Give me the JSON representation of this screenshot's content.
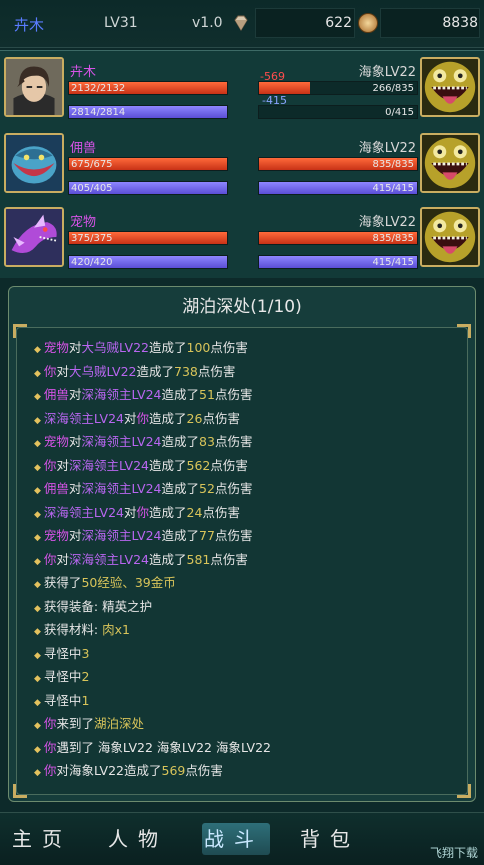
{
  "topbar": {
    "player_name": "卉木",
    "level": "LV31",
    "version": "v1.0",
    "gems": "622",
    "gold": "8838"
  },
  "party": [
    {
      "name": "卉木",
      "hp": "2132/2132",
      "hp_frac": 1.0,
      "mp": "2814/2814",
      "mp_frac": 1.0,
      "avatar_icon": "hero-portrait-icon",
      "enemy": {
        "name": "海象LV22",
        "hp": "266/835",
        "hp_frac": 0.32,
        "mp": "0/415",
        "mp_frac": 0.0,
        "damage_hp": "-569",
        "damage_mp": "-415",
        "icon": "sea-monster-icon"
      }
    },
    {
      "name": "佣兽",
      "hp": "675/675",
      "hp_frac": 1.0,
      "mp": "405/405",
      "mp_frac": 1.0,
      "avatar_icon": "blue-beast-icon",
      "enemy": {
        "name": "海象LV22",
        "hp": "835/835",
        "hp_frac": 1.0,
        "mp": "415/415",
        "mp_frac": 1.0,
        "icon": "sea-monster-icon"
      }
    },
    {
      "name": "宠物",
      "hp": "375/375",
      "hp_frac": 1.0,
      "mp": "420/420",
      "mp_frac": 1.0,
      "avatar_icon": "purple-dragon-icon",
      "enemy": {
        "name": "海象LV22",
        "hp": "835/835",
        "hp_frac": 1.0,
        "mp": "415/415",
        "mp_frac": 1.0,
        "icon": "sea-monster-icon"
      }
    }
  ],
  "battle": {
    "title": "湖泊深处(1/10)",
    "log": [
      [
        {
          "t": "宠物",
          "c": "pk"
        },
        {
          "t": "对",
          "c": "wh"
        },
        {
          "t": "大乌贼LV22",
          "c": "en"
        },
        {
          "t": "造成了",
          "c": "wh"
        },
        {
          "t": "100",
          "c": "ye"
        },
        {
          "t": "点伤害",
          "c": "wh"
        }
      ],
      [
        {
          "t": "你",
          "c": "pk"
        },
        {
          "t": "对",
          "c": "wh"
        },
        {
          "t": "大乌贼LV22",
          "c": "en"
        },
        {
          "t": "造成了",
          "c": "wh"
        },
        {
          "t": "738",
          "c": "ye"
        },
        {
          "t": "点伤害",
          "c": "wh"
        }
      ],
      [
        {
          "t": "佣兽",
          "c": "pk"
        },
        {
          "t": "对",
          "c": "wh"
        },
        {
          "t": "深海领主LV24",
          "c": "en"
        },
        {
          "t": "造成了",
          "c": "wh"
        },
        {
          "t": "51",
          "c": "ye"
        },
        {
          "t": "点伤害",
          "c": "wh"
        }
      ],
      [
        {
          "t": "深海领主LV24",
          "c": "en"
        },
        {
          "t": "对",
          "c": "wh"
        },
        {
          "t": "你",
          "c": "pk"
        },
        {
          "t": "造成了",
          "c": "wh"
        },
        {
          "t": "26",
          "c": "ye"
        },
        {
          "t": "点伤害",
          "c": "wh"
        }
      ],
      [
        {
          "t": "宠物",
          "c": "pk"
        },
        {
          "t": "对",
          "c": "wh"
        },
        {
          "t": "深海领主LV24",
          "c": "en"
        },
        {
          "t": "造成了",
          "c": "wh"
        },
        {
          "t": "83",
          "c": "ye"
        },
        {
          "t": "点伤害",
          "c": "wh"
        }
      ],
      [
        {
          "t": "你",
          "c": "pk"
        },
        {
          "t": "对",
          "c": "wh"
        },
        {
          "t": "深海领主LV24",
          "c": "en"
        },
        {
          "t": "造成了",
          "c": "wh"
        },
        {
          "t": "562",
          "c": "ye"
        },
        {
          "t": "点伤害",
          "c": "wh"
        }
      ],
      [
        {
          "t": "佣兽",
          "c": "pk"
        },
        {
          "t": "对",
          "c": "wh"
        },
        {
          "t": "深海领主LV24",
          "c": "en"
        },
        {
          "t": "造成了",
          "c": "wh"
        },
        {
          "t": "52",
          "c": "ye"
        },
        {
          "t": "点伤害",
          "c": "wh"
        }
      ],
      [
        {
          "t": "深海领主LV24",
          "c": "en"
        },
        {
          "t": "对",
          "c": "wh"
        },
        {
          "t": "你",
          "c": "pk"
        },
        {
          "t": "造成了",
          "c": "wh"
        },
        {
          "t": "24",
          "c": "ye"
        },
        {
          "t": "点伤害",
          "c": "wh"
        }
      ],
      [
        {
          "t": "宠物",
          "c": "pk"
        },
        {
          "t": "对",
          "c": "wh"
        },
        {
          "t": "深海领主LV24",
          "c": "en"
        },
        {
          "t": "造成了",
          "c": "wh"
        },
        {
          "t": "77",
          "c": "ye"
        },
        {
          "t": "点伤害",
          "c": "wh"
        }
      ],
      [
        {
          "t": "你",
          "c": "pk"
        },
        {
          "t": "对",
          "c": "wh"
        },
        {
          "t": "深海领主LV24",
          "c": "en"
        },
        {
          "t": "造成了",
          "c": "wh"
        },
        {
          "t": "581",
          "c": "ye"
        },
        {
          "t": "点伤害",
          "c": "wh"
        }
      ],
      [
        {
          "t": "获得了",
          "c": "wh"
        },
        {
          "t": "50经验、39金币",
          "c": "ye"
        }
      ],
      [
        {
          "t": "获得装备: 精英之护",
          "c": "wh"
        }
      ],
      [
        {
          "t": "获得材料: ",
          "c": "wh"
        },
        {
          "t": "肉x1",
          "c": "ye"
        }
      ],
      [
        {
          "t": "寻怪中",
          "c": "wh"
        },
        {
          "t": "3",
          "c": "ye"
        }
      ],
      [
        {
          "t": "寻怪中",
          "c": "wh"
        },
        {
          "t": "2",
          "c": "ye"
        }
      ],
      [
        {
          "t": "寻怪中",
          "c": "wh"
        },
        {
          "t": "1",
          "c": "ye"
        }
      ],
      [
        {
          "t": "你",
          "c": "pk"
        },
        {
          "t": "来到了",
          "c": "wh"
        },
        {
          "t": "湖泊深处",
          "c": "ye"
        }
      ],
      [
        {
          "t": "你",
          "c": "pk"
        },
        {
          "t": "遇到了 海象LV22 海象LV22 海象LV22",
          "c": "wh"
        }
      ],
      [
        {
          "t": "你",
          "c": "pk"
        },
        {
          "t": "对海象LV22造成了",
          "c": "wh"
        },
        {
          "t": "569",
          "c": "ye"
        },
        {
          "t": "点伤害",
          "c": "wh"
        }
      ]
    ]
  },
  "nav": {
    "tabs": [
      {
        "label": "主页",
        "active": false
      },
      {
        "label": "人物",
        "active": false
      },
      {
        "label": "战斗",
        "active": true
      },
      {
        "label": "背包",
        "active": false
      },
      {
        "label": "",
        "active": false
      }
    ]
  },
  "watermark": "飞翔下载"
}
